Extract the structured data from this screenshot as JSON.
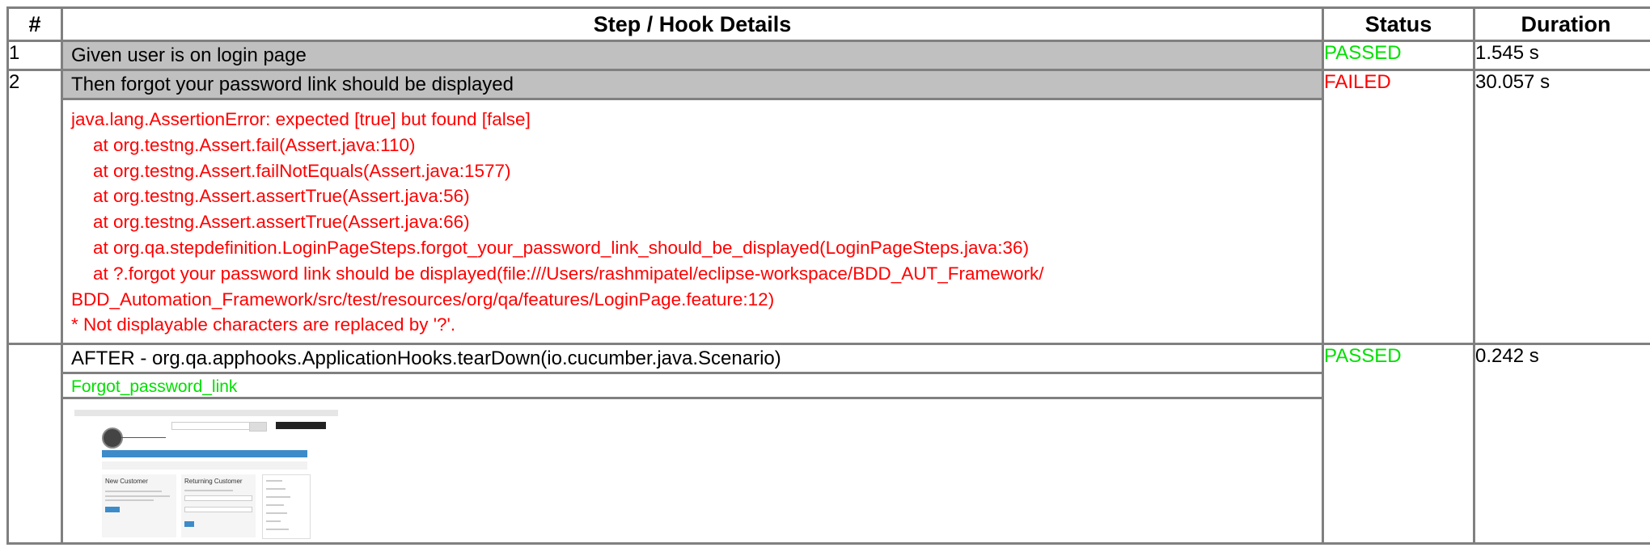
{
  "headers": {
    "num": "#",
    "step": "Step / Hook Details",
    "status": "Status",
    "duration": "Duration"
  },
  "rows": [
    {
      "num": "1",
      "step": "Given user is on login page",
      "status": "PASSED",
      "duration": "1.545 s"
    },
    {
      "num": "2",
      "step": "Then forgot your password link should be displayed",
      "status": "FAILED",
      "duration": "30.057 s",
      "error": {
        "line1": "java.lang.AssertionError: expected [true] but found [false]",
        "trace": [
          "at org.testng.Assert.fail(Assert.java:110)",
          "at org.testng.Assert.failNotEquals(Assert.java:1577)",
          "at org.testng.Assert.assertTrue(Assert.java:56)",
          "at org.testng.Assert.assertTrue(Assert.java:66)",
          "at org.qa.stepdefinition.LoginPageSteps.forgot_your_password_link_should_be_displayed(LoginPageSteps.java:36)",
          "at ?.forgot your password link should be displayed(file:///Users/rashmipatel/eclipse-workspace/BDD_AUT_Framework/"
        ],
        "wrap": "BDD_Automation_Framework/src/test/resources/org/qa/features/LoginPage.feature:12)",
        "note": "* Not displayable characters are replaced by '?'."
      }
    },
    {
      "num": "",
      "step": "AFTER - org.qa.apphooks.ApplicationHooks.tearDown(io.cucumber.java.Scenario)",
      "status": "PASSED",
      "duration": "0.242 s",
      "embedding": "Forgot_password_link",
      "screenshot": {
        "left_panel_title": "New Customer",
        "right_panel_title": "Returning Customer"
      }
    }
  ],
  "colors": {
    "passed": "#00e000",
    "failed": "#ff0000",
    "step_bar": "#c0c0c0",
    "border": "#808080"
  }
}
